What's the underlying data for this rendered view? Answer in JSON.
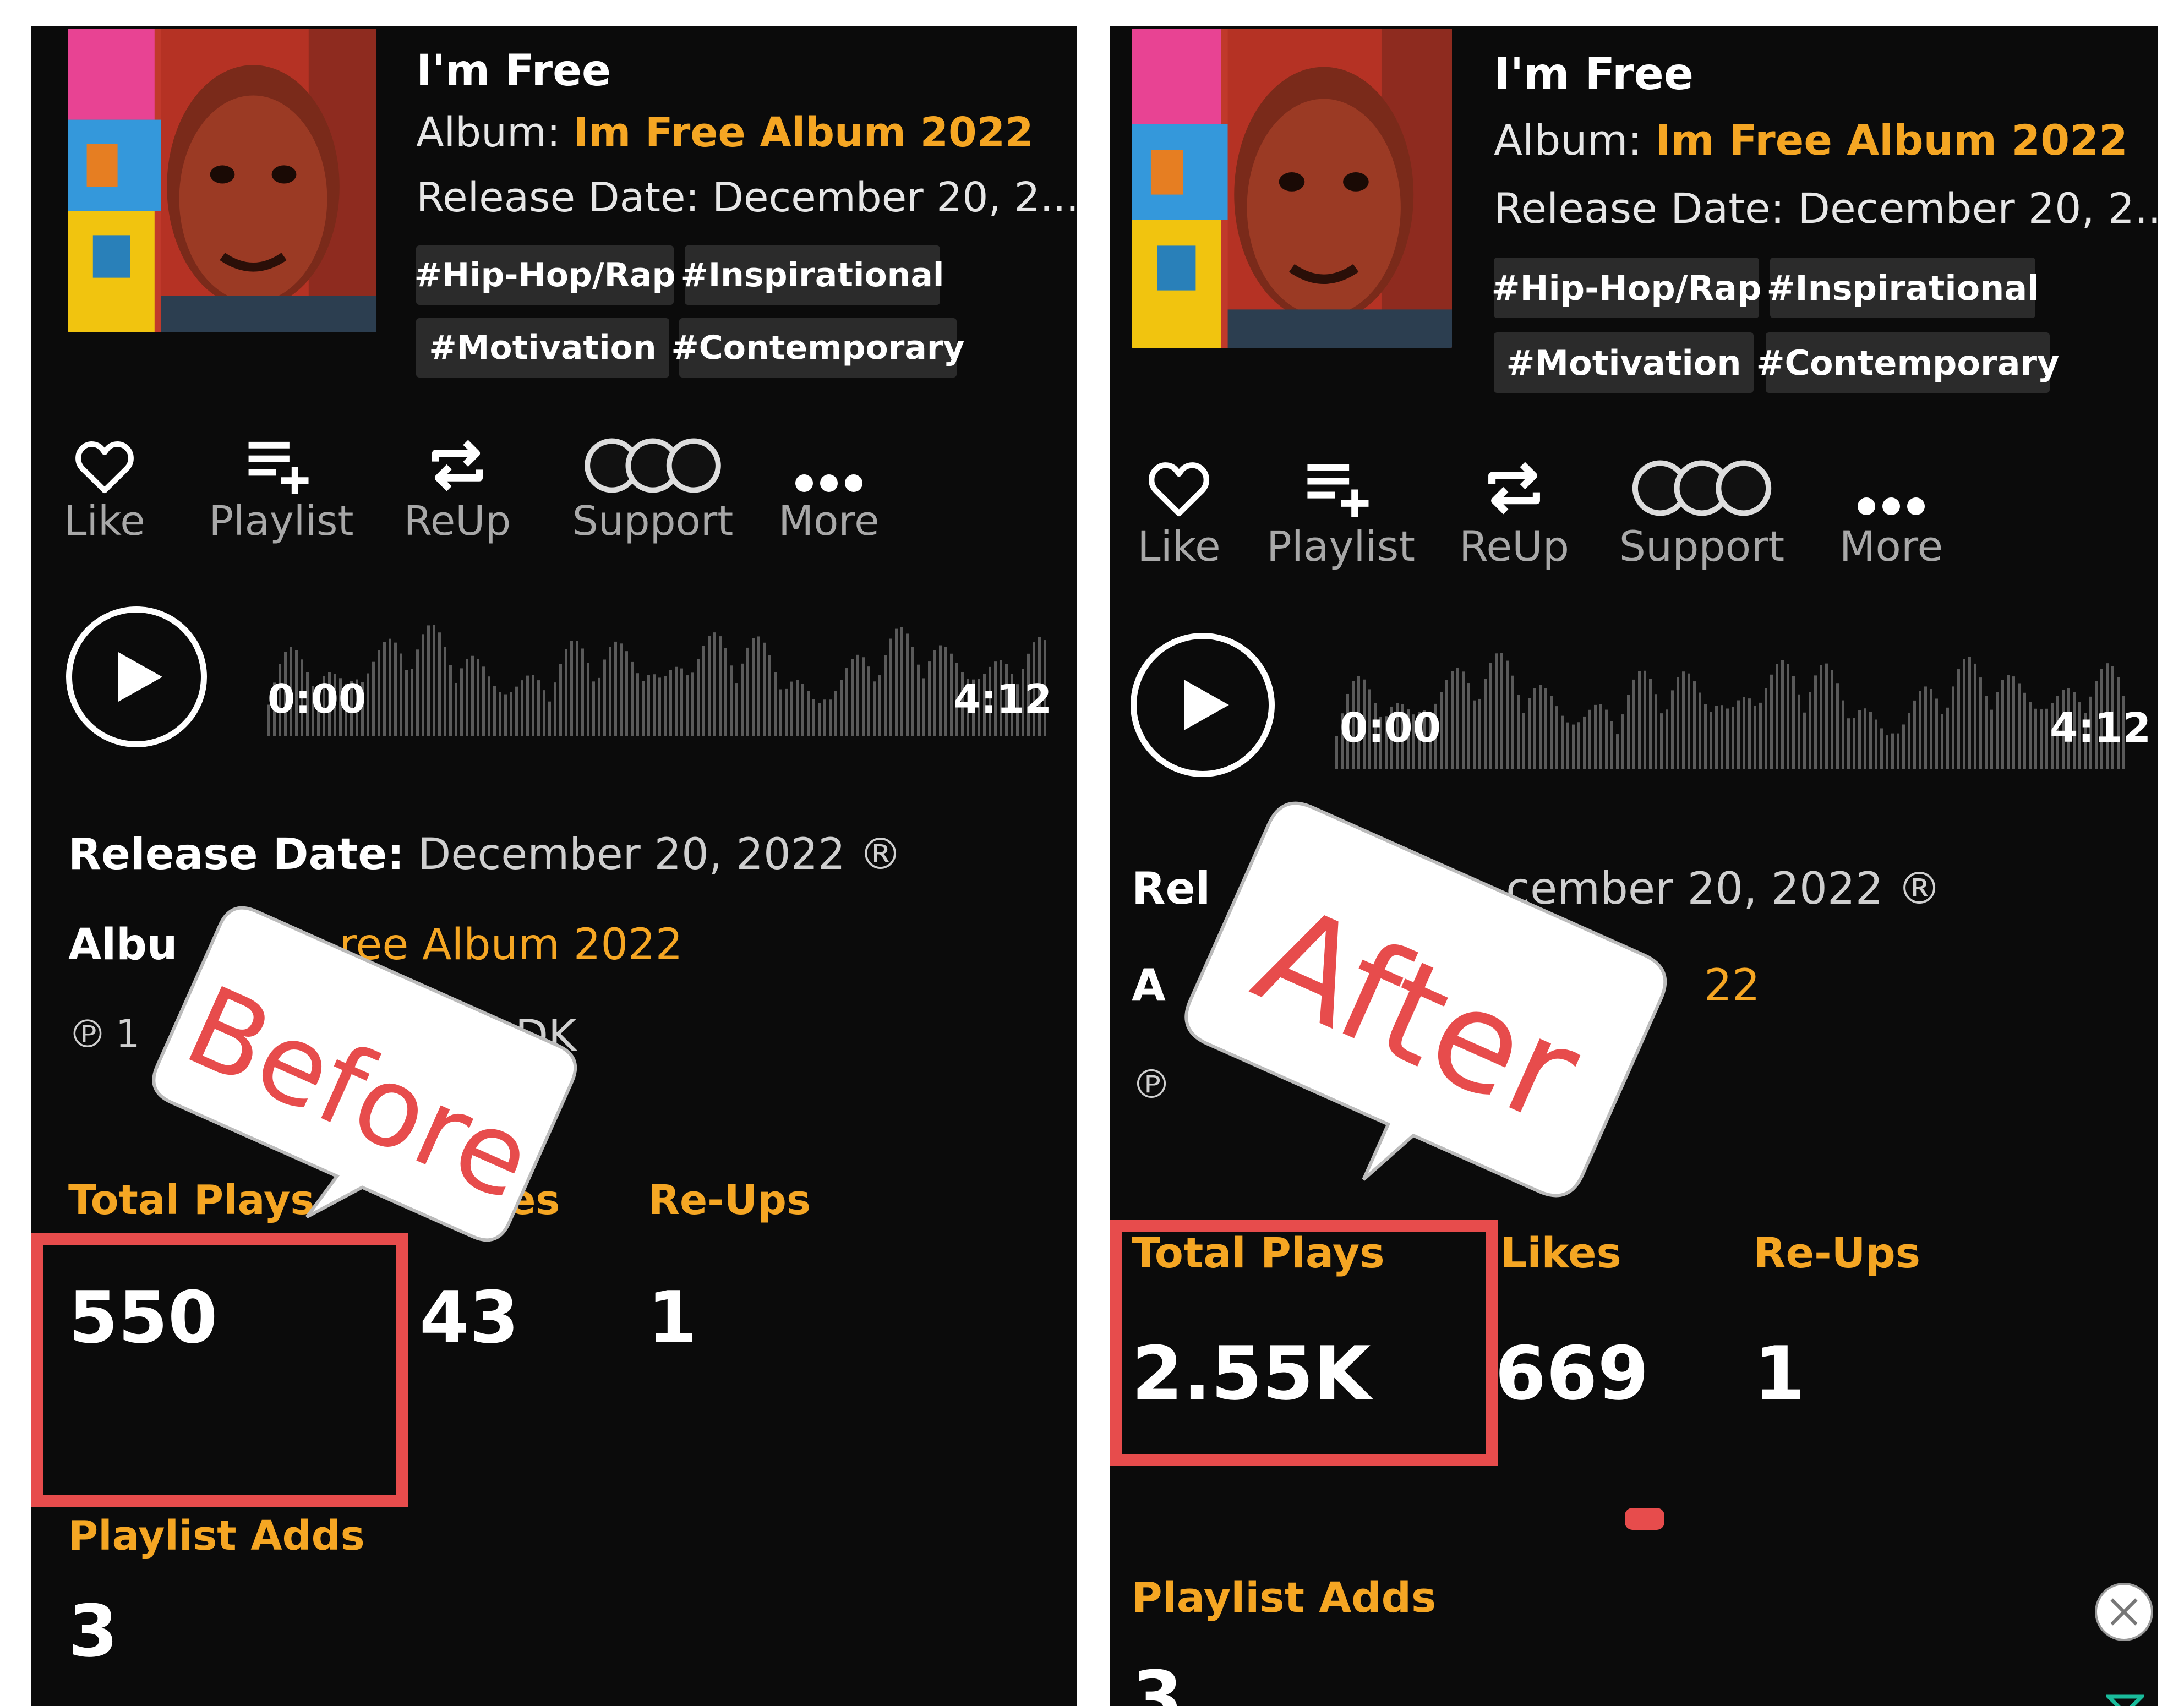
{
  "before": {
    "track": {
      "title": "I'm Free",
      "album_prefix": "Album: ",
      "album": "Im Free Album 2022",
      "release_line": "Release Date: December 20, 2...",
      "tags": [
        "#Hip-Hop/Rap",
        "#Inspirational",
        "#Motivation",
        "#Contemporary"
      ]
    },
    "actions": [
      {
        "label": "Like",
        "icon": "heart-icon"
      },
      {
        "label": "Playlist",
        "icon": "playlist-add-icon"
      },
      {
        "label": "ReUp",
        "icon": "repost-icon"
      },
      {
        "label": "Support",
        "icon": "support-icon"
      },
      {
        "label": "More",
        "icon": "more-icon"
      }
    ],
    "player": {
      "current_time": "0:00",
      "duration": "4:12"
    },
    "details": {
      "release_label": "Release Date:",
      "release_value": "December 20, 2022 ®",
      "album_label": "Albu",
      "album_value": "ree Album 2022",
      "copyright_symbol": "℗",
      "copyright_frag_1": "1",
      "copyright_frag_2": "DK"
    },
    "stats": {
      "total_plays_label": "Total Plays",
      "total_plays_value": "550",
      "likes_label": "kes",
      "likes_value": "43",
      "reups_label": "Re-Ups",
      "reups_value": "1",
      "playlist_adds_label": "Playlist Adds",
      "playlist_adds_value": "3"
    },
    "callout": "Before"
  },
  "after": {
    "track": {
      "title": "I'm Free",
      "album_prefix": "Album: ",
      "album": "Im Free Album 2022",
      "release_line": "Release Date: December 20, 2...",
      "tags": [
        "#Hip-Hop/Rap",
        "#Inspirational",
        "#Motivation",
        "#Contemporary"
      ]
    },
    "actions": [
      {
        "label": "Like",
        "icon": "heart-icon"
      },
      {
        "label": "Playlist",
        "icon": "playlist-add-icon"
      },
      {
        "label": "ReUp",
        "icon": "repost-icon"
      },
      {
        "label": "Support",
        "icon": "support-icon"
      },
      {
        "label": "More",
        "icon": "more-icon"
      }
    ],
    "player": {
      "current_time": "0:00",
      "duration": "4:12"
    },
    "details": {
      "release_label": "Rel",
      "release_value": "cember 20, 2022 ®",
      "album_label": "A",
      "album_value": "22",
      "copyright_symbol": "℗"
    },
    "stats": {
      "total_plays_label": "Total Plays",
      "total_plays_value": "2.55K",
      "likes_label": "Likes",
      "likes_value": "669",
      "reups_label": "Re-Ups",
      "reups_value": "1",
      "playlist_adds_label": "Playlist Adds",
      "playlist_adds_value": "3"
    },
    "callout": "After",
    "close_icon": "close-icon"
  },
  "colors": {
    "background": "#0b0b0b",
    "accent": "#f5a623",
    "highlight": "#e74c4c",
    "tag_bg": "#2b2b2b"
  }
}
